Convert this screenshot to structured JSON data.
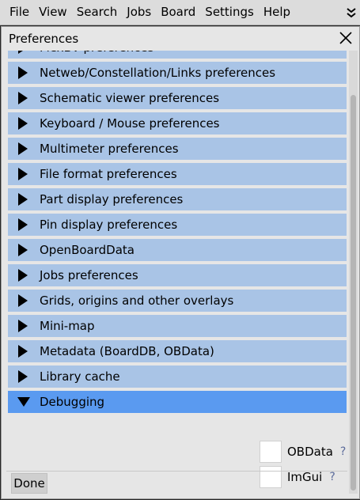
{
  "menubar": {
    "items": [
      "File",
      "View",
      "Search",
      "Jobs",
      "Board",
      "Settings",
      "Help"
    ],
    "overflow_icon": "double-chevron-down-icon"
  },
  "dialog": {
    "title": "Preferences",
    "close_icon": "close-icon",
    "sections": [
      {
        "label": "FlexBV preferences",
        "expanded": false
      },
      {
        "label": "Netweb/Constellation/Links preferences",
        "expanded": false
      },
      {
        "label": "Schematic viewer preferences",
        "expanded": false
      },
      {
        "label": "Keyboard / Mouse preferences",
        "expanded": false
      },
      {
        "label": "Multimeter preferences",
        "expanded": false
      },
      {
        "label": "File format preferences",
        "expanded": false
      },
      {
        "label": "Part display preferences",
        "expanded": false
      },
      {
        "label": "Pin display preferences",
        "expanded": false
      },
      {
        "label": "OpenBoardData",
        "expanded": false
      },
      {
        "label": "Jobs preferences",
        "expanded": false
      },
      {
        "label": "Grids, origins and other overlays",
        "expanded": false
      },
      {
        "label": "Mini-map",
        "expanded": false
      },
      {
        "label": "Metadata (BoardDB, OBData)",
        "expanded": false
      },
      {
        "label": "Library cache",
        "expanded": false
      },
      {
        "label": "Debugging",
        "expanded": true
      }
    ],
    "debugging": {
      "checkboxes": [
        {
          "label": "OBData",
          "checked": false,
          "help": "?"
        },
        {
          "label": "ImGui",
          "checked": false,
          "help": "?"
        }
      ]
    },
    "done_label": "Done"
  },
  "colors": {
    "header_collapsed": "#a9c4e6",
    "header_expanded": "#5a9af0",
    "dialog_bg": "#e6e6e6"
  }
}
